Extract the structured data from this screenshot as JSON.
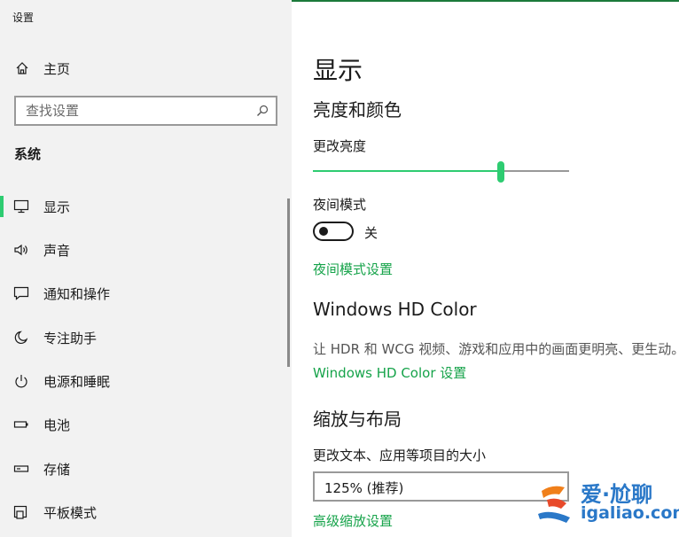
{
  "window": {
    "title": "设置"
  },
  "sidebar": {
    "home_label": "主页",
    "search_placeholder": "查找设置",
    "section_title": "系统",
    "items": [
      {
        "label": "显示",
        "icon": "monitor-icon",
        "active": true
      },
      {
        "label": "声音",
        "icon": "speaker-icon",
        "active": false
      },
      {
        "label": "通知和操作",
        "icon": "message-icon",
        "active": false
      },
      {
        "label": "专注助手",
        "icon": "moon-icon",
        "active": false
      },
      {
        "label": "电源和睡眠",
        "icon": "power-icon",
        "active": false
      },
      {
        "label": "电池",
        "icon": "battery-icon",
        "active": false
      },
      {
        "label": "存储",
        "icon": "drive-icon",
        "active": false
      },
      {
        "label": "平板模式",
        "icon": "tablet-icon",
        "active": false
      }
    ]
  },
  "main": {
    "page_title": "显示",
    "brightness_section": "亮度和颜色",
    "brightness_label": "更改亮度",
    "brightness_value": 0.74,
    "night_mode_label": "夜间模式",
    "night_mode_state": "关",
    "night_mode_settings_link": "夜间模式设置",
    "hdr_section": "Windows HD Color",
    "hdr_desc": "让 HDR 和 WCG 视频、游戏和应用中的画面更明亮、更生动。",
    "hdr_link": "Windows HD Color 设置",
    "scale_section": "缩放与布局",
    "scale_label": "更改文本、应用等项目的大小",
    "scale_value": "125% (推荐)",
    "advanced_scale_link": "高级缩放设置"
  },
  "watermark": {
    "line1": "爱·尬聊",
    "line2": "igaliao.com"
  },
  "colors": {
    "accent": "#2ecc71",
    "link": "#16a34a",
    "sidebar_bg": "#f2f2f2",
    "watermark": "#2a78c8"
  }
}
